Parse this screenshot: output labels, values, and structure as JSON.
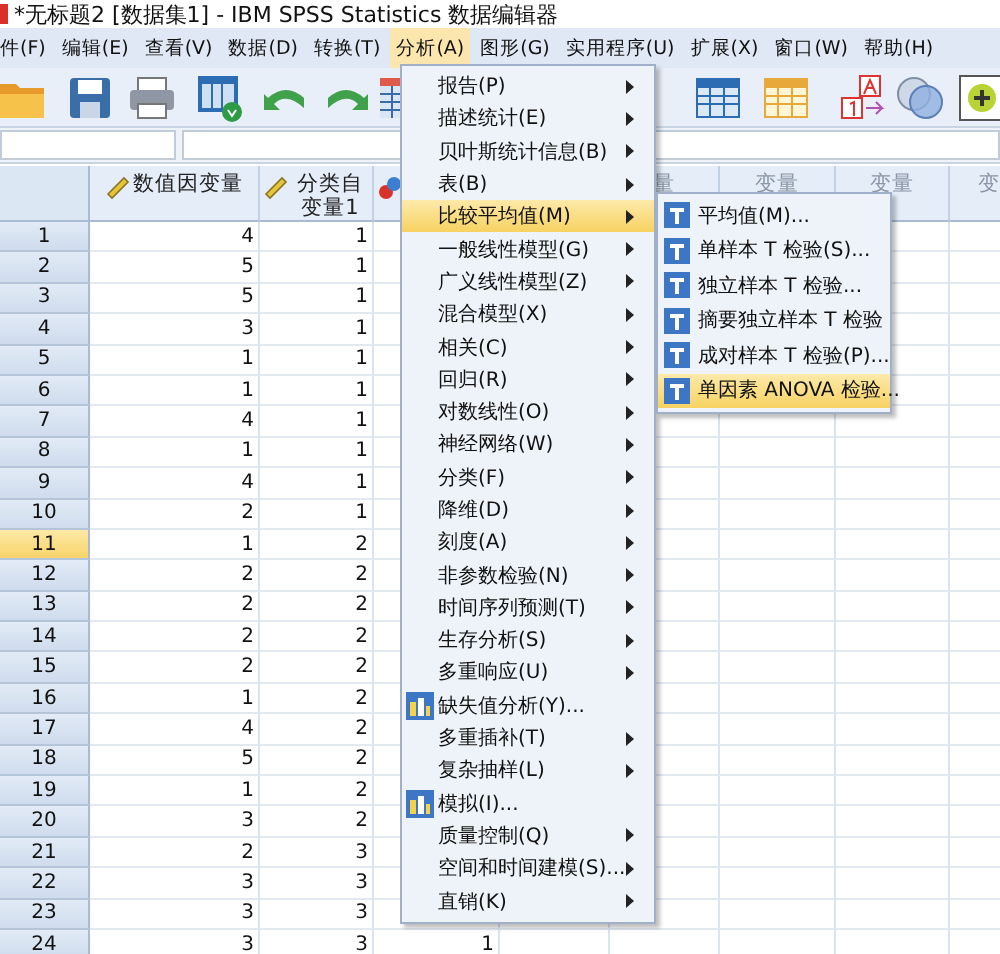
{
  "window": {
    "title": "*无标题2 [数据集1] - IBM SPSS Statistics 数据编辑器"
  },
  "menubar": [
    {
      "label": "件(F)",
      "selected": false
    },
    {
      "label": "编辑(E)",
      "selected": false
    },
    {
      "label": "查看(V)",
      "selected": false
    },
    {
      "label": "数据(D)",
      "selected": false
    },
    {
      "label": "转换(T)",
      "selected": false
    },
    {
      "label": "分析(A)",
      "selected": true
    },
    {
      "label": "图形(G)",
      "selected": false
    },
    {
      "label": "实用程序(U)",
      "selected": false
    },
    {
      "label": "扩展(X)",
      "selected": false
    },
    {
      "label": "窗口(W)",
      "selected": false
    },
    {
      "label": "帮助(H)",
      "selected": false
    }
  ],
  "columns": [
    {
      "label": "数值因变量",
      "kind": "scale"
    },
    {
      "label": "分类自变量1",
      "kind": "scale"
    },
    {
      "kind": "nominal"
    },
    {},
    {
      "label": "量"
    },
    {
      "label": "变量"
    },
    {
      "label": "变量"
    },
    {
      "label": "变"
    }
  ],
  "rows": [
    {
      "number": "1",
      "selected": false,
      "cells": [
        "4",
        "1"
      ]
    },
    {
      "number": "2",
      "selected": false,
      "cells": [
        "5",
        "1"
      ]
    },
    {
      "number": "3",
      "selected": false,
      "cells": [
        "5",
        "1"
      ]
    },
    {
      "number": "4",
      "selected": false,
      "cells": [
        "3",
        "1"
      ]
    },
    {
      "number": "5",
      "selected": false,
      "cells": [
        "1",
        "1"
      ]
    },
    {
      "number": "6",
      "selected": false,
      "cells": [
        "1",
        "1"
      ]
    },
    {
      "number": "7",
      "selected": false,
      "cells": [
        "4",
        "1"
      ]
    },
    {
      "number": "8",
      "selected": false,
      "cells": [
        "1",
        "1"
      ]
    },
    {
      "number": "9",
      "selected": false,
      "cells": [
        "4",
        "1"
      ]
    },
    {
      "number": "10",
      "selected": false,
      "cells": [
        "2",
        "1"
      ]
    },
    {
      "number": "11",
      "selected": true,
      "cells": [
        "1",
        "2"
      ]
    },
    {
      "number": "12",
      "selected": false,
      "cells": [
        "2",
        "2"
      ]
    },
    {
      "number": "13",
      "selected": false,
      "cells": [
        "2",
        "2"
      ]
    },
    {
      "number": "14",
      "selected": false,
      "cells": [
        "2",
        "2"
      ]
    },
    {
      "number": "15",
      "selected": false,
      "cells": [
        "2",
        "2"
      ]
    },
    {
      "number": "16",
      "selected": false,
      "cells": [
        "1",
        "2"
      ]
    },
    {
      "number": "17",
      "selected": false,
      "cells": [
        "4",
        "2"
      ]
    },
    {
      "number": "18",
      "selected": false,
      "cells": [
        "5",
        "2"
      ]
    },
    {
      "number": "19",
      "selected": false,
      "cells": [
        "1",
        "2"
      ]
    },
    {
      "number": "20",
      "selected": false,
      "cells": [
        "3",
        "2"
      ]
    },
    {
      "number": "21",
      "selected": false,
      "cells": [
        "2",
        "3"
      ]
    },
    {
      "number": "22",
      "selected": false,
      "cells": [
        "3",
        "3"
      ]
    },
    {
      "number": "23",
      "selected": false,
      "cells": [
        "3",
        "3"
      ]
    },
    {
      "number": "24",
      "selected": false,
      "cells": [
        "3",
        "3",
        "1"
      ]
    }
  ],
  "analyze_menu": [
    {
      "label": "报告(P)",
      "submenu": true,
      "icon": false,
      "selected": false
    },
    {
      "label": "描述统计(E)",
      "submenu": true,
      "icon": false,
      "selected": false
    },
    {
      "label": "贝叶斯统计信息(B)",
      "submenu": true,
      "icon": false,
      "selected": false
    },
    {
      "label": "表(B)",
      "submenu": true,
      "icon": false,
      "selected": false
    },
    {
      "label": "比较平均值(M)",
      "submenu": true,
      "icon": false,
      "selected": true
    },
    {
      "label": "一般线性模型(G)",
      "submenu": true,
      "icon": false,
      "selected": false
    },
    {
      "label": "广义线性模型(Z)",
      "submenu": true,
      "icon": false,
      "selected": false
    },
    {
      "label": "混合模型(X)",
      "submenu": true,
      "icon": false,
      "selected": false
    },
    {
      "label": "相关(C)",
      "submenu": true,
      "icon": false,
      "selected": false
    },
    {
      "label": "回归(R)",
      "submenu": true,
      "icon": false,
      "selected": false
    },
    {
      "label": "对数线性(O)",
      "submenu": true,
      "icon": false,
      "selected": false
    },
    {
      "label": "神经网络(W)",
      "submenu": true,
      "icon": false,
      "selected": false
    },
    {
      "label": "分类(F)",
      "submenu": true,
      "icon": false,
      "selected": false
    },
    {
      "label": "降维(D)",
      "submenu": true,
      "icon": false,
      "selected": false
    },
    {
      "label": "刻度(A)",
      "submenu": true,
      "icon": false,
      "selected": false
    },
    {
      "label": "非参数检验(N)",
      "submenu": true,
      "icon": false,
      "selected": false
    },
    {
      "label": "时间序列预测(T)",
      "submenu": true,
      "icon": false,
      "selected": false
    },
    {
      "label": "生存分析(S)",
      "submenu": true,
      "icon": false,
      "selected": false
    },
    {
      "label": "多重响应(U)",
      "submenu": true,
      "icon": false,
      "selected": false
    },
    {
      "label": "缺失值分析(Y)...",
      "submenu": false,
      "icon": true,
      "selected": false
    },
    {
      "label": "多重插补(T)",
      "submenu": true,
      "icon": false,
      "selected": false
    },
    {
      "label": "复杂抽样(L)",
      "submenu": true,
      "icon": false,
      "selected": false
    },
    {
      "label": "模拟(I)...",
      "submenu": false,
      "icon": true,
      "selected": false
    },
    {
      "label": "质量控制(Q)",
      "submenu": true,
      "icon": false,
      "selected": false
    },
    {
      "label": "空间和时间建模(S)...",
      "submenu": true,
      "icon": false,
      "selected": false
    },
    {
      "label": "直销(K)",
      "submenu": true,
      "icon": false,
      "selected": false
    }
  ],
  "compare_means_menu": [
    {
      "label": "平均值(M)...",
      "selected": false
    },
    {
      "label": "单样本 T 检验(S)...",
      "selected": false
    },
    {
      "label": "独立样本 T 检验...",
      "selected": false
    },
    {
      "label": "摘要独立样本 T 检验",
      "selected": false
    },
    {
      "label": "成对样本 T 检验(P)...",
      "selected": false
    },
    {
      "label": "单因素 ANOVA 检验...",
      "selected": true
    }
  ]
}
